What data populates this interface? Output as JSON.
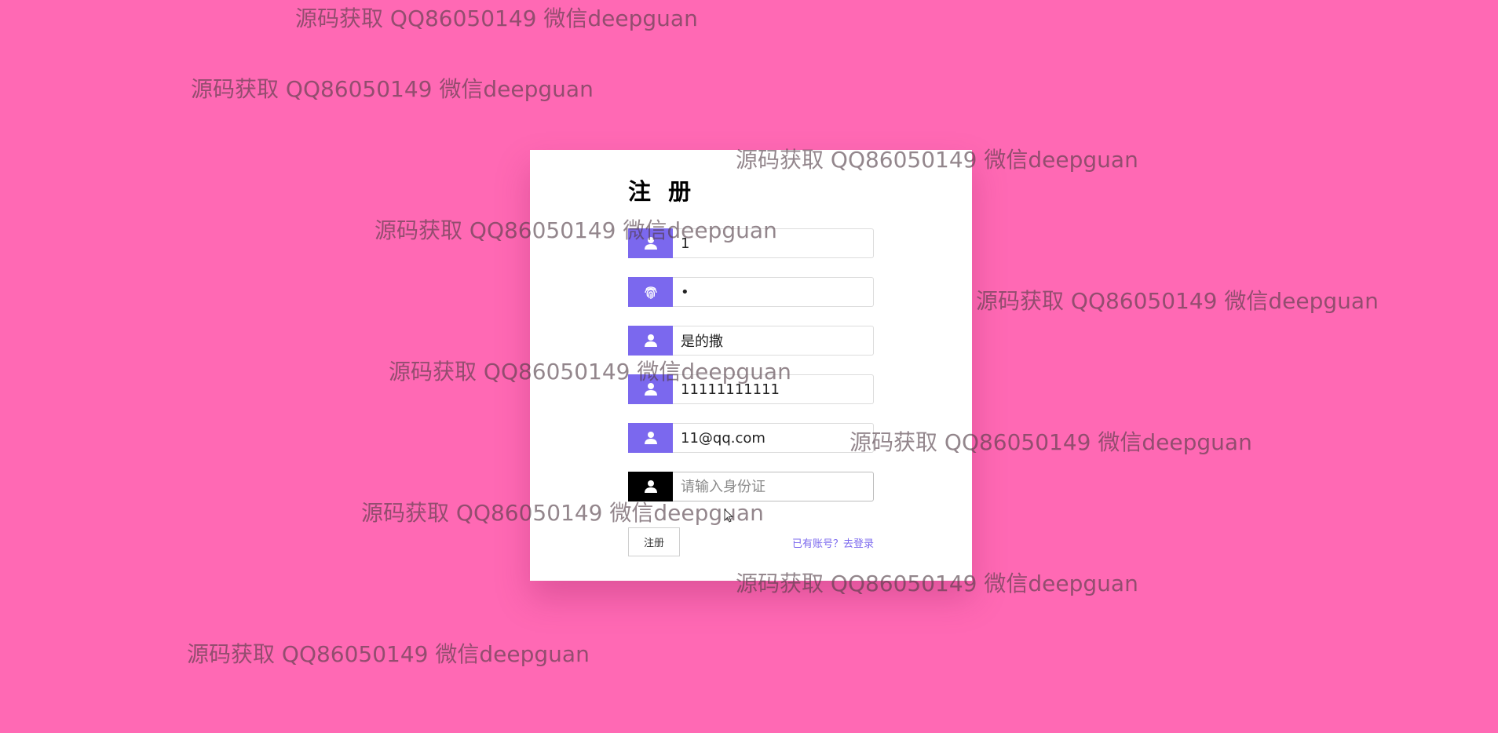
{
  "form": {
    "title": "注 册",
    "fields": [
      {
        "icon": "user-icon",
        "value": "1",
        "placeholder": ""
      },
      {
        "icon": "fingerprint-icon",
        "value": "•",
        "placeholder": ""
      },
      {
        "icon": "user-icon",
        "value": "是的撒",
        "placeholder": ""
      },
      {
        "icon": "user-icon",
        "value": "11111111111",
        "placeholder": ""
      },
      {
        "icon": "user-icon",
        "value": "11@qq.com",
        "placeholder": ""
      },
      {
        "icon": "user-icon",
        "value": "",
        "placeholder": "请输入身份证"
      }
    ],
    "submit_label": "注册",
    "login_link": "已有账号？去登录"
  },
  "watermark_text": "源码获取 QQ86050149 微信deepguan",
  "colors": {
    "background": "#ff69b4",
    "accent": "#7b68ee",
    "active_icon_bg": "#000000",
    "card": "#ffffff"
  }
}
